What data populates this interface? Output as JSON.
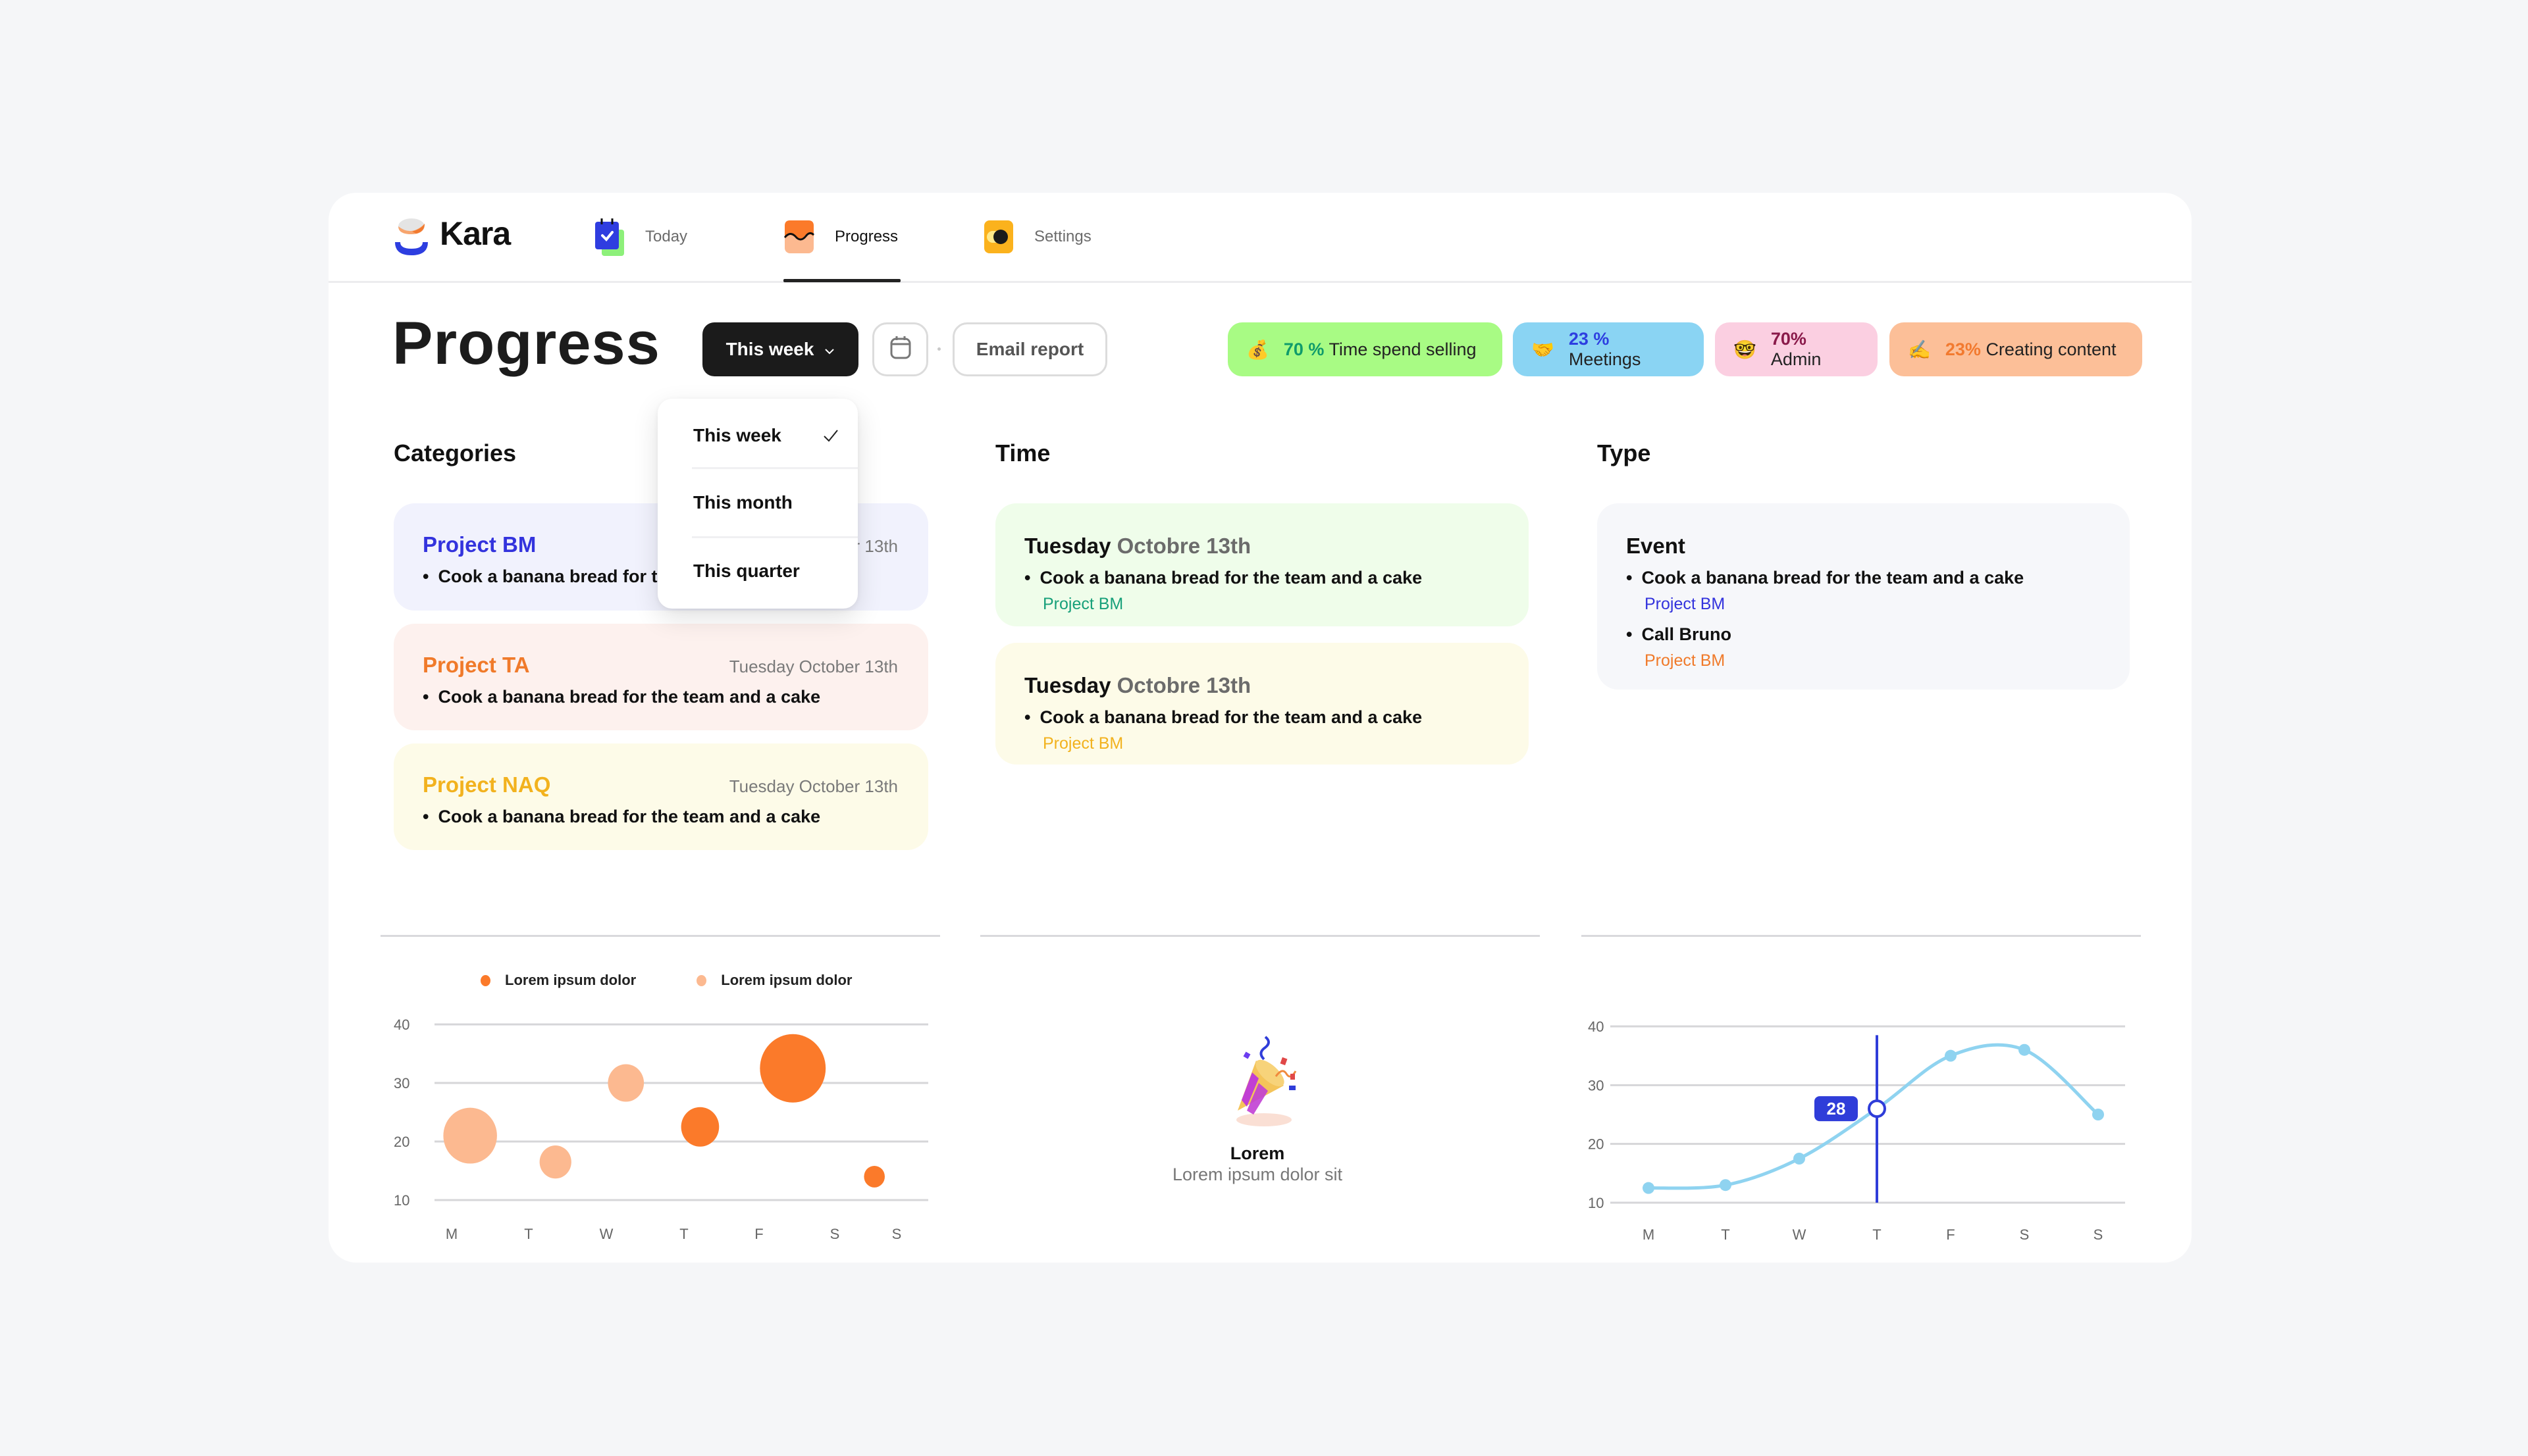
{
  "app": {
    "name": "Kara"
  },
  "nav": {
    "items": [
      {
        "label": "Today",
        "icon": "calendar-check-icon"
      },
      {
        "label": "Progress",
        "icon": "progress-wave-icon",
        "active": true
      },
      {
        "label": "Settings",
        "icon": "toggle-icon"
      }
    ]
  },
  "header": {
    "title": "Progress",
    "period_button": "This week",
    "calendar_icon": "calendar-icon",
    "email_button": "Email report"
  },
  "period_dropdown": {
    "options": [
      {
        "label": "This week",
        "selected": true
      },
      {
        "label": "This month"
      },
      {
        "label": "This quarter"
      }
    ]
  },
  "badges": [
    {
      "emoji": "💰",
      "percent": "70 %",
      "label": "Time spend selling",
      "bg": "#a8fb84",
      "accent": "#0f9b6b"
    },
    {
      "emoji": "🤝",
      "percent": "23 %",
      "label": "Meetings",
      "bg": "#8ad4f3",
      "accent": "#2d3ee0"
    },
    {
      "emoji": "🤓",
      "percent": "70%",
      "label": "Admin",
      "bg": "#fbcfe1",
      "accent": "#8a1a4a"
    },
    {
      "emoji": "✍️",
      "percent": "23%",
      "label": "Creating content",
      "bg": "#fcbf98",
      "accent": "#f27a2f"
    }
  ],
  "sections": {
    "categories": {
      "title": "Categories",
      "cards": [
        {
          "project": "Project BM",
          "date": "Tuesday October 13th",
          "task": "Cook a banana bread for the team and a cake",
          "bg": "#f1f2fd",
          "color": "#3333dd"
        },
        {
          "project": "Project TA",
          "date": "Tuesday October 13th",
          "task": "Cook a banana bread for the team and a cake",
          "bg": "#fdf1ee",
          "color": "#f07a2a"
        },
        {
          "project": "Project NAQ",
          "date": "Tuesday October 13th",
          "task": "Cook a banana bread for the team and a cake",
          "bg": "#fdfbe8",
          "color": "#f2b21e"
        }
      ]
    },
    "time": {
      "title": "Time",
      "cards": [
        {
          "day": "Tuesday",
          "date": "Octobre 13th",
          "task": "Cook a banana bread for the team and a cake",
          "project": "Project BM",
          "bg": "#effdea",
          "color": "#17a07a"
        },
        {
          "day": "Tuesday",
          "date": "Octobre 13th",
          "task": "Cook a banana bread for the team and a cake",
          "project": "Project BM",
          "bg": "#fdfbe8",
          "color": "#f2b21e"
        }
      ]
    },
    "type": {
      "title": "Type",
      "card": {
        "heading": "Event",
        "items": [
          {
            "task": "Cook a banana bread for the team and a cake",
            "project": "Project BM",
            "color": "#3333dd"
          },
          {
            "task": "Call Bruno",
            "project": "Project BM",
            "color": "#f07a2a"
          }
        ]
      }
    }
  },
  "empty_state": {
    "icon": "party-popper-icon",
    "title": "Lorem",
    "subtitle": "Lorem ipsum dolor sit"
  },
  "chart_data": [
    {
      "type": "scatter",
      "variant": "bubble",
      "title": "",
      "xlabel": "",
      "ylabel": "",
      "categories": [
        "M",
        "T",
        "W",
        "T",
        "F",
        "S",
        "S"
      ],
      "yticks": [
        10,
        20,
        30,
        40
      ],
      "ylim": [
        10,
        40
      ],
      "grid": true,
      "legend": "top-center",
      "series": [
        {
          "name": "Lorem ipsum dolor",
          "color": "#fb7a2a",
          "points": [
            {
              "x": 3.35,
              "y": 22.5,
              "size": 10
            },
            {
              "x": 4.6,
              "y": 32.5,
              "size": 30
            },
            {
              "x": 5.7,
              "y": 14,
              "size": 3
            }
          ]
        },
        {
          "name": "Lorem ipsum dolor",
          "color": "#fcb990",
          "points": [
            {
              "x": 0.25,
              "y": 21,
              "size": 20
            },
            {
              "x": 1.4,
              "y": 16.5,
              "size": 7
            },
            {
              "x": 2.35,
              "y": 30,
              "size": 9
            }
          ]
        }
      ]
    },
    {
      "type": "line",
      "title": "",
      "xlabel": "",
      "ylabel": "",
      "categories": [
        "M",
        "T",
        "W",
        "T",
        "F",
        "S",
        "S"
      ],
      "yticks": [
        10,
        20,
        30,
        40
      ],
      "ylim": [
        10,
        40
      ],
      "grid": true,
      "series": [
        {
          "name": "",
          "color": "#8fd3f0",
          "values": [
            12.5,
            13,
            17.5,
            26,
            35,
            36,
            25
          ]
        }
      ],
      "highlight": {
        "index": 3,
        "label": "28",
        "color": "#2f3dd9"
      }
    }
  ]
}
